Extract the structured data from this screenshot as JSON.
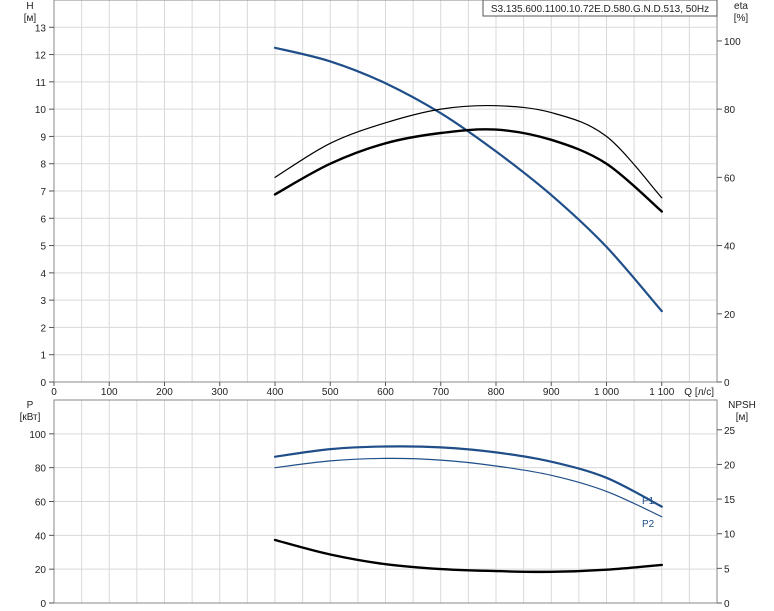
{
  "chart_data": [
    {
      "type": "line",
      "title": "S3.135.600.1100.10.72E.D.580.G.N.D.513, 50Hz",
      "xlabel": "Q [л/с]",
      "x_unit": "Q [л/с]",
      "xlim": [
        0,
        1200
      ],
      "x_ticks": [
        0,
        100,
        200,
        300,
        400,
        500,
        600,
        700,
        800,
        900,
        1000,
        1100
      ],
      "x_tick_labels": [
        "0",
        "100",
        "200",
        "300",
        "400",
        "500",
        "600",
        "700",
        "800",
        "900",
        "1 000",
        "1 100"
      ],
      "left_axis": {
        "label": "H",
        "unit": "[м]",
        "lim": [
          0,
          14
        ],
        "ticks": [
          0,
          1,
          2,
          3,
          4,
          5,
          6,
          7,
          8,
          9,
          10,
          11,
          12,
          13
        ]
      },
      "right_axis": {
        "label": "eta",
        "unit": "[%]",
        "lim": [
          0,
          112
        ],
        "ticks": [
          0,
          20,
          40,
          60,
          80,
          100
        ]
      },
      "grid": true,
      "series": [
        {
          "axis": "left",
          "color": "#1f4e89",
          "width": 2.2,
          "x": [
            400,
            500,
            600,
            700,
            800,
            900,
            1000,
            1100
          ],
          "y": [
            12.25,
            11.75,
            10.95,
            9.85,
            8.45,
            6.85,
            4.95,
            2.6
          ]
        },
        {
          "axis": "right",
          "color": "#000000",
          "width": 1.2,
          "x": [
            400,
            500,
            600,
            700,
            800,
            900,
            1000,
            1100
          ],
          "y": [
            60,
            70,
            76,
            80,
            81,
            79,
            72,
            54
          ]
        },
        {
          "axis": "right",
          "color": "#000000",
          "width": 2.4,
          "x": [
            400,
            500,
            600,
            700,
            800,
            900,
            1000,
            1100
          ],
          "y": [
            55,
            64,
            70,
            73,
            74,
            71,
            64,
            50
          ]
        }
      ]
    },
    {
      "type": "line",
      "xlim": [
        0,
        1200
      ],
      "x_ticks": [
        0,
        100,
        200,
        300,
        400,
        500,
        600,
        700,
        800,
        900,
        1000,
        1100
      ],
      "left_axis": {
        "label": "P",
        "unit": "[кВт]",
        "lim": [
          0,
          120
        ],
        "ticks": [
          0,
          20,
          40,
          60,
          80,
          100
        ]
      },
      "right_axis": {
        "label": "NPSH",
        "unit": "[м]",
        "lim": [
          0,
          29.3
        ],
        "ticks": [
          0,
          5,
          10,
          15,
          20,
          25
        ]
      },
      "grid": true,
      "series": [
        {
          "name": "P1",
          "axis": "left",
          "color": "#1f4e89",
          "width": 2.2,
          "x": [
            400,
            500,
            600,
            700,
            800,
            900,
            1000,
            1100
          ],
          "y": [
            86.5,
            91,
            92.5,
            92,
            89,
            83.5,
            74,
            57
          ]
        },
        {
          "name": "P2",
          "axis": "left",
          "color": "#1f4e89",
          "width": 1.2,
          "x": [
            400,
            500,
            600,
            700,
            800,
            900,
            1000,
            1100
          ],
          "y": [
            80,
            84,
            85.5,
            84.5,
            81,
            75.5,
            66,
            51
          ]
        },
        {
          "axis": "right",
          "color": "#000000",
          "width": 2.4,
          "x": [
            400,
            500,
            600,
            700,
            800,
            900,
            1000,
            1100
          ],
          "y": [
            9.1,
            7.0,
            5.6,
            4.9,
            4.6,
            4.5,
            4.8,
            5.5
          ]
        }
      ]
    }
  ]
}
